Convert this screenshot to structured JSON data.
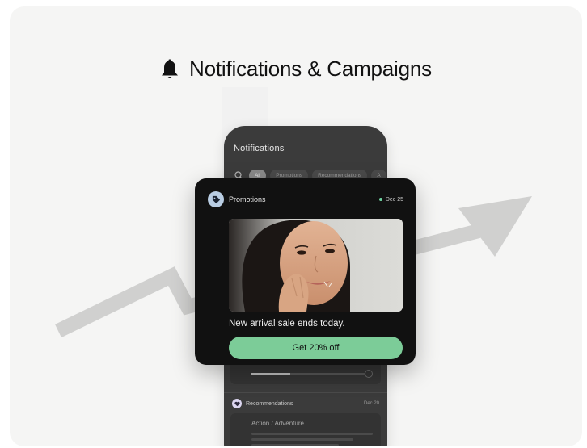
{
  "header": {
    "title": "Notifications & Campaigns",
    "icon": "bell-icon"
  },
  "phone": {
    "title": "Notifications",
    "filters": [
      {
        "label": "All",
        "active": true
      },
      {
        "label": "Promotions",
        "active": false
      },
      {
        "label": "Recommendations",
        "active": false
      },
      {
        "label": "A",
        "active": false
      }
    ],
    "recommendation": {
      "category": "Recommendations",
      "date": "Dec 20",
      "card_title": "Action / Adventure",
      "icon": "heart-icon"
    }
  },
  "popup": {
    "category": "Promotions",
    "category_icon": "tag-icon",
    "date": "Dec 25",
    "message": "New arrival sale ends today.",
    "cta_label": "Get 20% off"
  },
  "colors": {
    "cta": "#7ccc98",
    "status_dot": "#6fd4a2",
    "arrow": "#d0d0cf",
    "popup_bg": "#111111",
    "phone_bg": "#3b3b3b"
  }
}
